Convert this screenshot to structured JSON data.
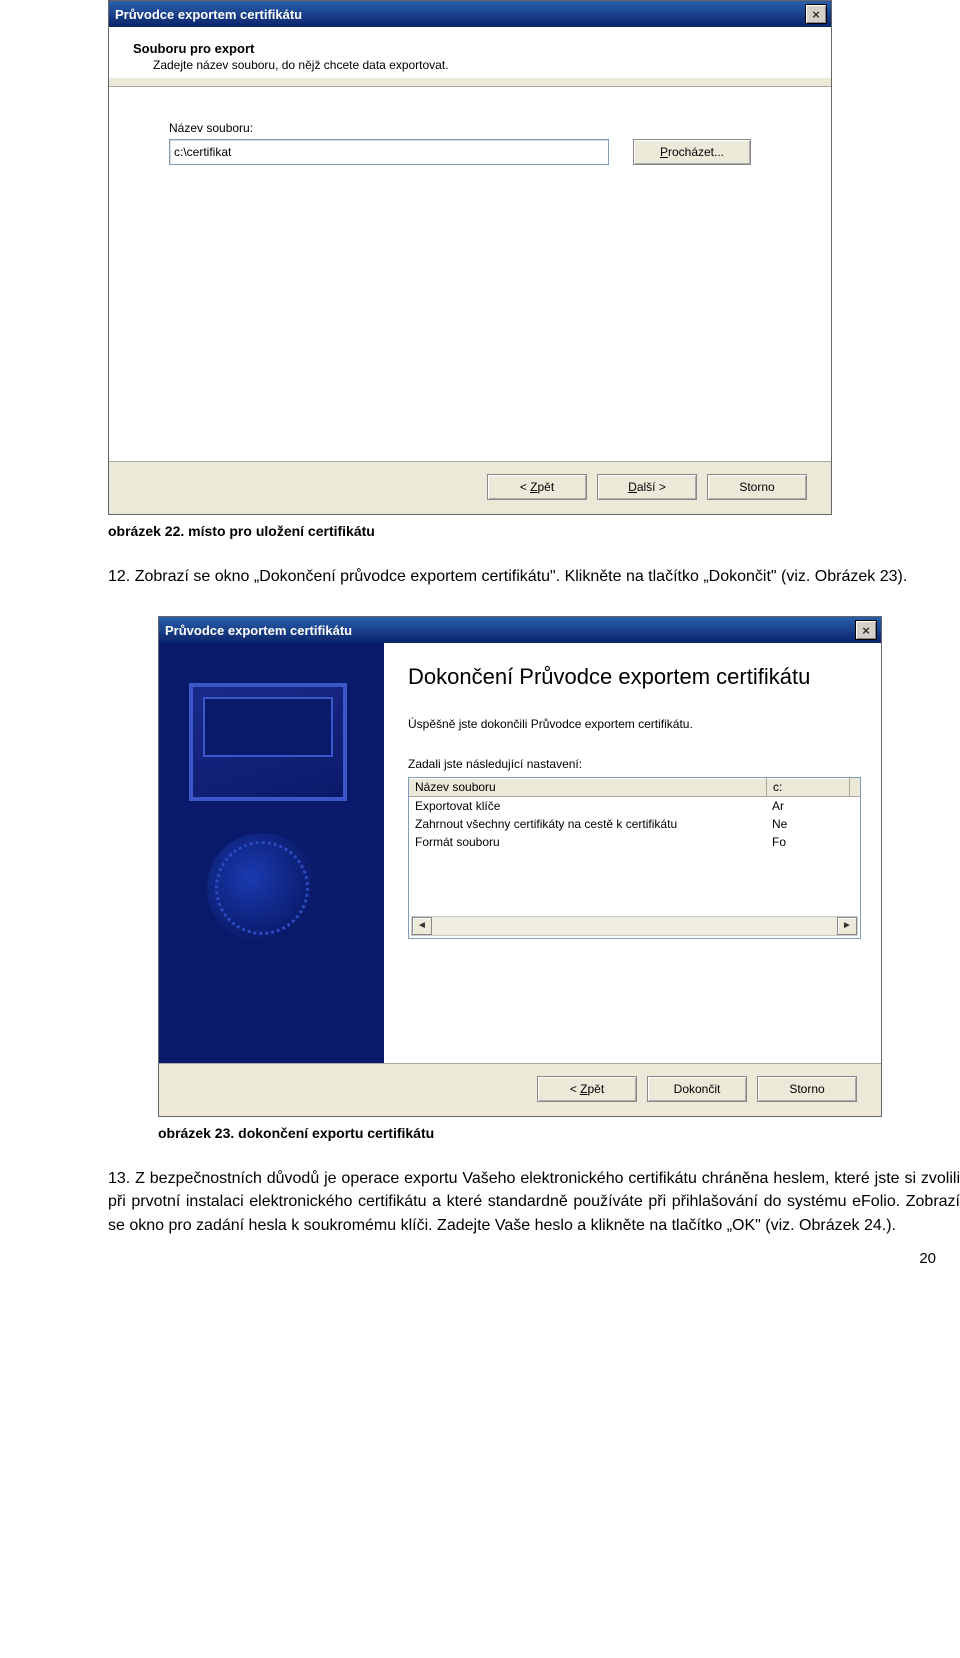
{
  "dialog1": {
    "title": "Průvodce exportem certifikátu",
    "header": "Souboru pro export",
    "subheader": "Zadejte název souboru, do nějž chcete data exportovat.",
    "file_label": "Název souboru:",
    "file_value": "c:\\certifikat",
    "browse_label": "Procházet...",
    "back_label": "< Zpět",
    "next_label": "Další >",
    "cancel_label": "Storno"
  },
  "caption1": "obrázek 22. místo pro uložení certifikátu",
  "text12": "12. Zobrazí se okno „Dokončení průvodce exportem certifikátu\". Klikněte na tlačítko „Dokončit\" (viz. Obrázek 23).",
  "dialog2": {
    "title": "Průvodce exportem certifikátu",
    "heading": "Dokončení Průvodce exportem certifikátu",
    "success_text": "Úspěšně jste dokončili Průvodce exportem certifikátu.",
    "settings_label": "Zadali jste následující nastavení:",
    "columns": [
      {
        "c1": "Název souboru",
        "c2": "c:"
      },
      {
        "c1": "Exportovat klíče",
        "c2": "Ar"
      },
      {
        "c1": "Zahrnout všechny certifikáty na cestě k certifikátu",
        "c2": "Ne"
      },
      {
        "c1": "Formát souboru",
        "c2": "Fo"
      }
    ],
    "back_label": "< Zpět",
    "finish_label": "Dokončit",
    "cancel_label": "Storno"
  },
  "caption2": "obrázek 23. dokončení exportu certifikátu",
  "text13": "13. Z bezpečnostních důvodů je operace exportu Vašeho elektronického certifikátu chráněna heslem, které jste si zvolili při prvotní instalaci elektronického certifikátu a které standardně používáte při přihlašování do systému eFolio. Zobrazí se okno pro zadání hesla k soukromému klíči. Zadejte Vaše heslo a klikněte na tlačítko „OK\" (viz. Obrázek 24.).",
  "page_number": "20"
}
